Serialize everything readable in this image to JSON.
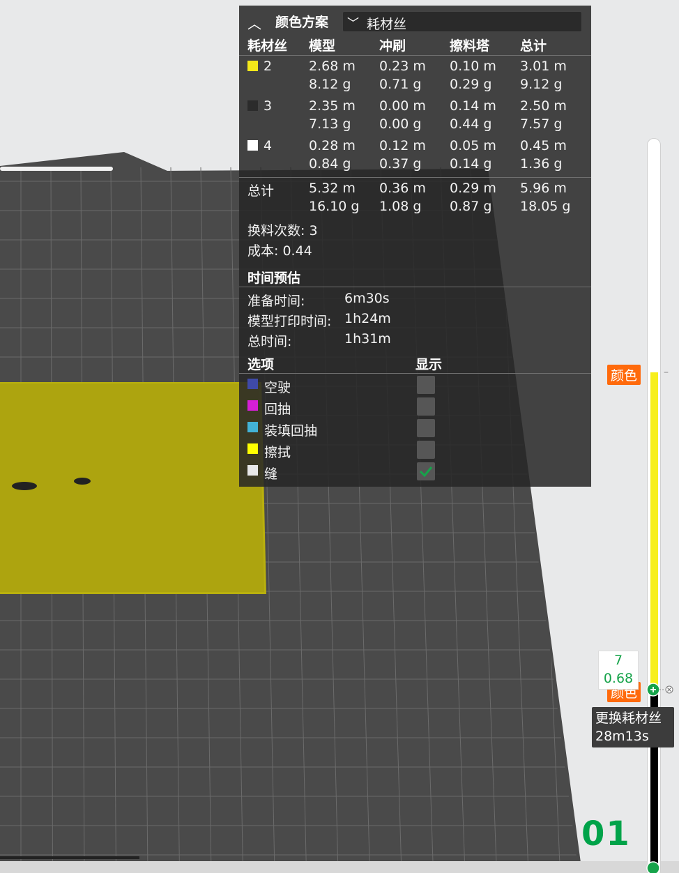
{
  "panel": {
    "scheme_title": "颜色方案",
    "scheme_value": "耗材丝",
    "columns": [
      "耗材丝",
      "模型",
      "冲刷",
      "擦料塔",
      "总计"
    ],
    "rows": [
      {
        "id": "2",
        "color": "#f3e81a",
        "model": [
          "2.68 m",
          "8.12 g"
        ],
        "flush": [
          "0.23 m",
          "0.71 g"
        ],
        "tower": [
          "0.10 m",
          "0.29 g"
        ],
        "total": [
          "3.01 m",
          "9.12 g"
        ]
      },
      {
        "id": "3",
        "color": "#2b2b2b",
        "model": [
          "2.35 m",
          "7.13 g"
        ],
        "flush": [
          "0.00 m",
          "0.00 g"
        ],
        "tower": [
          "0.14 m",
          "0.44 g"
        ],
        "total": [
          "2.50 m",
          "7.57 g"
        ]
      },
      {
        "id": "4",
        "color": "#ffffff",
        "model": [
          "0.28 m",
          "0.84 g"
        ],
        "flush": [
          "0.12 m",
          "0.37 g"
        ],
        "tower": [
          "0.05 m",
          "0.14 g"
        ],
        "total": [
          "0.45 m",
          "1.36 g"
        ]
      }
    ],
    "sum": {
      "label": "总计",
      "model": [
        "5.32 m",
        "16.10 g"
      ],
      "flush": [
        "0.36 m",
        "1.08 g"
      ],
      "tower": [
        "0.29 m",
        "0.87 g"
      ],
      "total": [
        "5.96 m",
        "18.05 g"
      ]
    },
    "changes": "换料次数: 3",
    "cost": "成本: 0.44",
    "time_title": "时间预估",
    "time": [
      {
        "label": "准备时间:",
        "value": "6m30s"
      },
      {
        "label": "模型打印时间:",
        "value": "1h24m"
      },
      {
        "label": "总时间:",
        "value": "1h31m"
      }
    ],
    "options_title": "选项",
    "show_title": "显示",
    "options": [
      {
        "label": "空驶",
        "color": "#3f4aa8",
        "checked": false
      },
      {
        "label": "回抽",
        "color": "#d61fd6",
        "checked": false
      },
      {
        "label": "装填回抽",
        "color": "#43b3d6",
        "checked": false
      },
      {
        "label": "擦拭",
        "color": "#ffff00",
        "checked": false
      },
      {
        "label": "缝",
        "color": "#e8e8e8",
        "checked": true
      }
    ]
  },
  "slider": {
    "top_tag": "颜色",
    "bottom_tag": "颜色",
    "layer": "7",
    "height": "0.68",
    "tooltip_title": "更换耗材丝",
    "tooltip_time": "28m13s"
  },
  "plate_number": "01",
  "colors": {
    "accent_orange": "#ff6a0c",
    "accent_green": "#16a34a",
    "filament_yellow": "#f3e81a"
  }
}
